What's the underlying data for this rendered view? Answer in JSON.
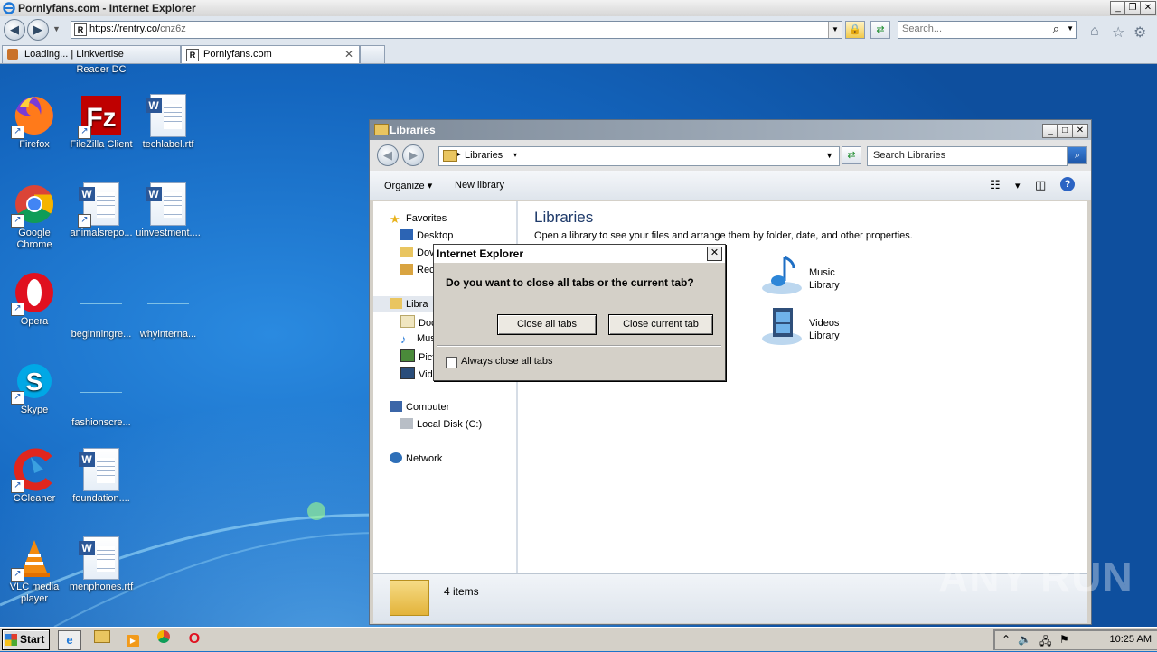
{
  "browser": {
    "window_title": "Pornlyfans.com - Internet Explorer",
    "url_host": "https://rentry.co/",
    "url_path": "cnz6z",
    "search_placeholder": "Search...",
    "tabs": [
      {
        "label": "Loading... | Linkvertise"
      },
      {
        "label": "Pornlyfans.com"
      }
    ]
  },
  "desktop": {
    "top_partial_label": "Reader DC",
    "icons": [
      {
        "label": "Firefox",
        "icon": "firefox-icon"
      },
      {
        "label": "FileZilla Client",
        "icon": "filezilla-icon"
      },
      {
        "label": "techlabel.rtf",
        "icon": "word-doc-icon"
      },
      {
        "label": "Google Chrome",
        "icon": "chrome-icon"
      },
      {
        "label": "animalsrepo...",
        "icon": "word-doc-icon"
      },
      {
        "label": "uinvestment....",
        "icon": "word-doc-icon"
      },
      {
        "label": "Opera",
        "icon": "opera-icon"
      },
      {
        "label": "beginningre...",
        "icon": "blank-file-icon"
      },
      {
        "label": "whyinterna...",
        "icon": "blank-file-icon"
      },
      {
        "label": "Skype",
        "icon": "skype-icon"
      },
      {
        "label": "fashionscre...",
        "icon": "blank-file-icon"
      },
      {
        "label": "CCleaner",
        "icon": "ccleaner-icon"
      },
      {
        "label": "foundation....",
        "icon": "word-doc-icon"
      },
      {
        "label": "VLC media player",
        "icon": "vlc-icon"
      },
      {
        "label": "menphones.rtf",
        "icon": "word-doc-icon"
      }
    ]
  },
  "explorer": {
    "title": "Libraries",
    "breadcrumb": "Libraries",
    "search_placeholder": "Search Libraries",
    "commands": {
      "organize": "Organize",
      "new_library": "New library"
    },
    "nav": {
      "favorites": "Favorites",
      "desktop": "Desktop",
      "downloads": "Dov",
      "recent": "Rec",
      "libraries": "Libra",
      "documents": "Doc",
      "music": "Mus",
      "pictures": "Pict",
      "videos": "Vide",
      "computer": "Computer",
      "local_disk": "Local Disk (C:)",
      "network": "Network"
    },
    "content_title": "Libraries",
    "content_subtitle": "Open a library to see your files and arrange them by folder, date, and other properties.",
    "libraries": [
      {
        "name": "Music",
        "type": "Library"
      },
      {
        "name": "Videos",
        "type": "Library"
      }
    ],
    "status_count": "4 items"
  },
  "dialog": {
    "title": "Internet Explorer",
    "question": "Do you want to close all tabs or the current tab?",
    "close_all_label": "Close all tabs",
    "close_current_label": "Close current tab",
    "checkbox_label": "Always close all tabs",
    "checkbox_checked": false
  },
  "taskbar": {
    "start_label": "Start",
    "clock": "10:25 AM"
  },
  "watermark": "ANY RUN"
}
